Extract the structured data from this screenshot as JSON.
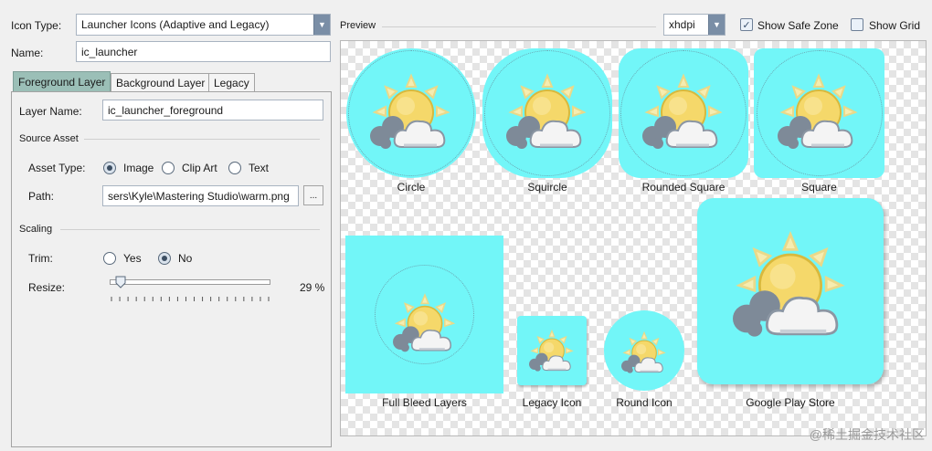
{
  "top": {
    "icon_type_label": "Icon Type:",
    "icon_type_value": "Launcher Icons (Adaptive and Legacy)",
    "name_label": "Name:",
    "name_value": "ic_launcher",
    "preview_label": "Preview",
    "density_value": "xhdpi",
    "show_safe_zone_label": "Show Safe Zone",
    "show_safe_zone_checked": true,
    "show_grid_label": "Show Grid",
    "show_grid_checked": false
  },
  "tabs": [
    {
      "label": "Foreground Layer",
      "active": true
    },
    {
      "label": "Background Layer",
      "active": false
    },
    {
      "label": "Legacy",
      "active": false
    }
  ],
  "form": {
    "layer_name_label": "Layer Name:",
    "layer_name_value": "ic_launcher_foreground",
    "source_asset_heading": "Source Asset",
    "asset_type_label": "Asset Type:",
    "asset_type_options": [
      "Image",
      "Clip Art",
      "Text"
    ],
    "asset_type_selected": "Image",
    "path_label": "Path:",
    "path_value": "sers\\Kyle\\Mastering Studio\\warm.png",
    "browse_label": "...",
    "scaling_heading": "Scaling",
    "trim_label": "Trim:",
    "trim_options": [
      "Yes",
      "No"
    ],
    "trim_selected": "No",
    "resize_label": "Resize:",
    "resize_value": "29 %",
    "resize_fraction": 0.07
  },
  "previews": [
    {
      "caption": "Circle"
    },
    {
      "caption": "Squircle"
    },
    {
      "caption": "Rounded Square"
    },
    {
      "caption": "Square"
    },
    {
      "caption": "Full Bleed Layers"
    },
    {
      "caption": "Legacy Icon"
    },
    {
      "caption": "Round Icon"
    },
    {
      "caption": "Google Play Store"
    }
  ],
  "colors": {
    "icon_background": "#72f6f8",
    "active_tab": "#9bbfb7",
    "combo_arrow": "#7a8ea6"
  },
  "icons": {
    "foreground": "sun-cloud-icon"
  },
  "watermark": "@稀土掘金技术社区"
}
